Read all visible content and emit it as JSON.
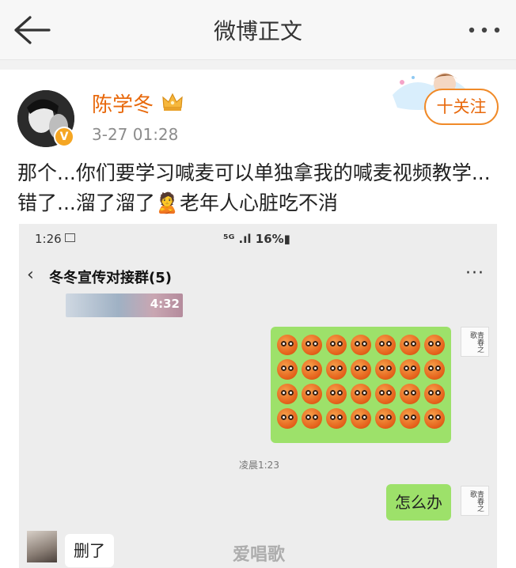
{
  "nav": {
    "title": "微博正文"
  },
  "post": {
    "username": "陈学冬",
    "timestamp": "3-27 01:28",
    "verified_badge": "V",
    "follow_label": "十关注",
    "text": "那个...你们要学习喊麦可以单独拿我的喊麦视频教学...错了...溜了溜了🙎老年人心脏吃不消"
  },
  "screenshot": {
    "status_time": "1:26",
    "status_right": "⁵ᴳ .ıl 16%▮",
    "chat_title": "冬冬宣传对接群(5)",
    "video_duration": "4:32",
    "emoji_rows": 4,
    "emoji_cols": 7,
    "chat_time": "凌晨1:23",
    "message_right": "怎么办",
    "message_left": "删了",
    "watermark": "爱唱歌",
    "calligraphy": "青春之歌"
  },
  "colors": {
    "username": "#e8690c",
    "follow_border": "#f08a28",
    "bubble_green": "#9de16a",
    "chat_bg": "#ededed"
  },
  "icons": [
    "back-arrow-icon",
    "more-dots-icon",
    "crown-icon",
    "verified-icon",
    "chat-back-icon",
    "chat-more-icon",
    "image-status-icon"
  ]
}
